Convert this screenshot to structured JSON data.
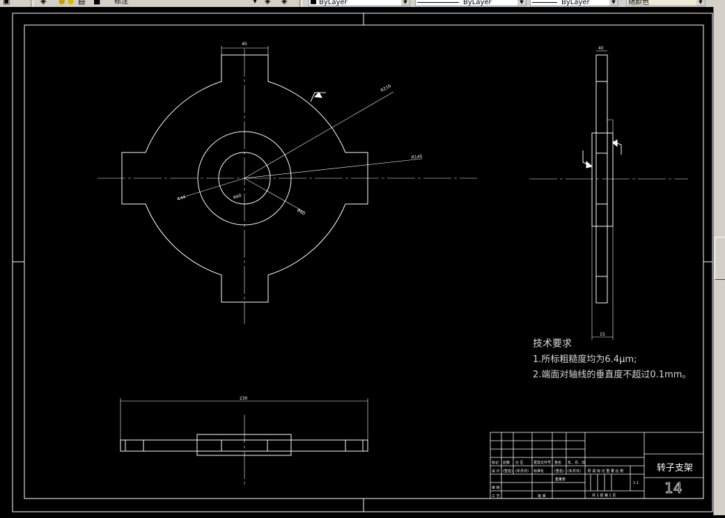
{
  "toolbar": {
    "layer_combo": "标注",
    "color_combo": "ByLayer",
    "linetype_combo": "ByLayer",
    "lineweight_combo": "ByLayer",
    "plotstyle_combo": "随颜色"
  },
  "drawing": {
    "dim_top_width": "40",
    "dim_r216": "R216",
    "dim_r145": "R145",
    "dim_phi44": "Φ44",
    "dim_phi60": "Φ60",
    "dim_r60": "R60",
    "dim_side_top": "40",
    "dim_side_bottom": "15",
    "dim_bottom_width": "230"
  },
  "notes": {
    "title": "技术要求",
    "line1": "1.所标粗糙度均为6.4μm;",
    "line2": "2.端面对轴线的垂直度不超过0.1mm。"
  },
  "title_block": {
    "part_name": "转子支架",
    "drawing_number": "14",
    "scale": "1:1",
    "sheet_text": "共 1 张  第 1 页",
    "row_labels": [
      "标记",
      "处数",
      "分 区",
      "更改文件号",
      "签名",
      "年、月、日"
    ],
    "row_labels2": [
      "设 计",
      "(签名)",
      "(年月日)",
      "标准化",
      "(签名)",
      "(年月日)"
    ],
    "left_labels": [
      "审 核",
      "工 艺"
    ],
    "approve": "批 准",
    "stage_header": "阶 段 标 记   重 量   比 例",
    "weight_label": "重量表"
  }
}
